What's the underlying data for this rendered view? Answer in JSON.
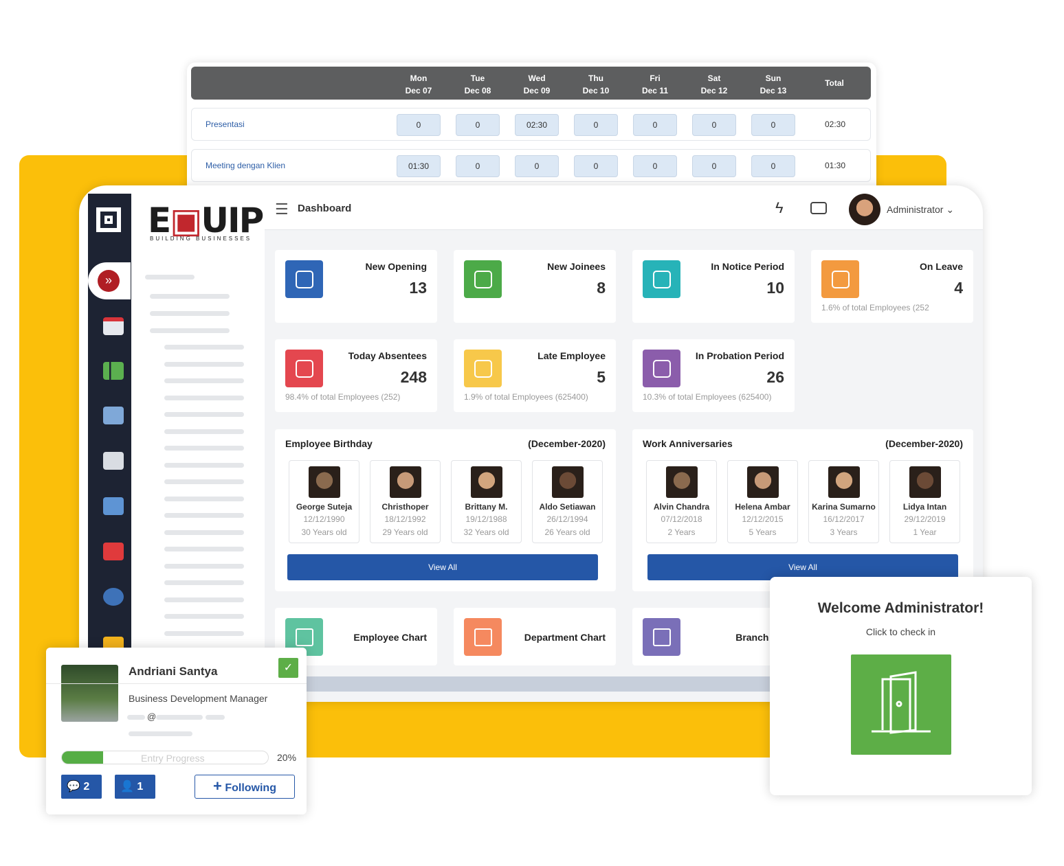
{
  "timesheet": {
    "days": [
      {
        "day": "Mon",
        "date": "Dec 07"
      },
      {
        "day": "Tue",
        "date": "Dec 08"
      },
      {
        "day": "Wed",
        "date": "Dec 09"
      },
      {
        "day": "Thu",
        "date": "Dec 10"
      },
      {
        "day": "Fri",
        "date": "Dec 11"
      },
      {
        "day": "Sat",
        "date": "Dec 12"
      },
      {
        "day": "Sun",
        "date": "Dec 13"
      }
    ],
    "total_label": "Total",
    "rows": [
      {
        "label": "Presentasi",
        "values": [
          "0",
          "0",
          "02:30",
          "0",
          "0",
          "0",
          "0"
        ],
        "total": "02:30"
      },
      {
        "label": "Meeting dengan Klien",
        "values": [
          "01:30",
          "0",
          "0",
          "0",
          "0",
          "0",
          "0"
        ],
        "total": "01:30"
      }
    ]
  },
  "brand": {
    "logo_text": "EQUIP",
    "tagline": "BUILDING BUSINESSES"
  },
  "header": {
    "title": "Dashboard",
    "user": "Administrator"
  },
  "stats": [
    {
      "title": "New Opening",
      "value": "13",
      "sub": "",
      "color": "#2f66b6",
      "icon": "search-user-icon"
    },
    {
      "title": "New Joinees",
      "value": "8",
      "sub": "",
      "color": "#4caa48",
      "icon": "add-user-icon"
    },
    {
      "title": "In Notice Period",
      "value": "10",
      "sub": "",
      "color": "#27b3b8",
      "icon": "hourglass-icon"
    },
    {
      "title": "On Leave",
      "value": "4",
      "sub": "1.6% of total Employees (252",
      "color": "#f39a3f",
      "icon": "calendar-star-icon"
    },
    {
      "title": "Today Absentees",
      "value": "248",
      "sub": "98.4% of total Employees (252)",
      "color": "#e4474f",
      "icon": "calendar-check-icon"
    },
    {
      "title": "Late Employee",
      "value": "5",
      "sub": "1.9% of total Employees (625400)",
      "color": "#f7c84a",
      "icon": "user-clock-icon"
    },
    {
      "title": "In Probation Period",
      "value": "26",
      "sub": "10.3% of total Employees (625400)",
      "color": "#8b5dab",
      "icon": "calendar-clock-icon"
    }
  ],
  "birthday": {
    "title": "Employee Birthday",
    "period": "(December-2020)",
    "view_all": "View All",
    "people": [
      {
        "name": "George Suteja",
        "date": "12/12/1990",
        "info": "30 Years old"
      },
      {
        "name": "Christhoper",
        "date": "18/12/1992",
        "info": "29 Years old"
      },
      {
        "name": "Brittany M.",
        "date": "19/12/1988",
        "info": "32 Years old"
      },
      {
        "name": "Aldo Setiawan",
        "date": "26/12/1994",
        "info": "26 Years old"
      }
    ]
  },
  "anniversary": {
    "title": "Work Anniversaries",
    "period": "(December-2020)",
    "view_all": "View All",
    "people": [
      {
        "name": "Alvin Chandra",
        "date": "07/12/2018",
        "info": "2 Years"
      },
      {
        "name": "Helena Ambar",
        "date": "12/12/2015",
        "info": "5 Years"
      },
      {
        "name": "Karina Sumarno",
        "date": "16/12/2017",
        "info": "3 Years"
      },
      {
        "name": "Lidya Intan",
        "date": "29/12/2019",
        "info": "1 Year"
      }
    ]
  },
  "charts": [
    {
      "label": "Employee Chart",
      "color": "#5fc3a0"
    },
    {
      "label": "Department Chart",
      "color": "#f5895f"
    },
    {
      "label": "Branch Ch",
      "color": "#7a6fb8"
    }
  ],
  "welcome": {
    "title": "Welcome Administrator!",
    "subtitle": "Click to check in",
    "color": "#5dae47"
  },
  "profile": {
    "name": "Andriani Santya",
    "role": "Business Development Manager",
    "progress_label": "Entry Progress",
    "progress_pct": 20,
    "progress_text": "20%",
    "messages": "2",
    "connections": "1",
    "follow_label": "Following"
  }
}
